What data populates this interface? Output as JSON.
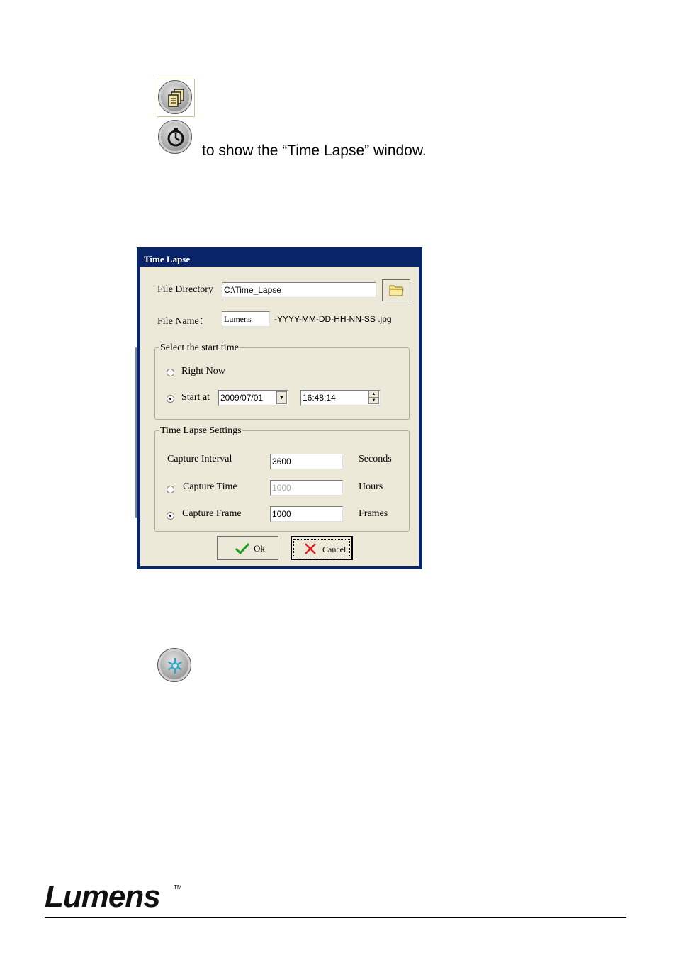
{
  "instruction_text": "to show the “Time Lapse” window.",
  "icons": {
    "stack": "stacked-pages-icon",
    "timer": "timer-icon",
    "freeze": "snowflake-icon"
  },
  "dialog": {
    "title": "Time Lapse",
    "file_directory_label": "File Directory",
    "file_directory_value": "C:\\Time_Lapse",
    "file_name_label": "File Name：",
    "file_name_value": "Lumens",
    "file_name_suffix": "-YYYY-MM-DD-HH-NN-SS .jpg",
    "start_group_title": "Select the start time",
    "right_now_label": "Right Now",
    "start_at_label": "Start at",
    "start_date": "2009/07/01",
    "start_time": "16:48:14",
    "settings_group_title": "Time Lapse Settings",
    "capture_interval_label": "Capture Interval",
    "capture_interval_value": "3600",
    "capture_interval_unit": "Seconds",
    "capture_time_label": "Capture Time",
    "capture_time_value": "1000",
    "capture_time_unit": "Hours",
    "capture_frame_label": "Capture Frame",
    "capture_frame_value": "1000",
    "capture_frame_unit": "Frames",
    "ok_label": "Ok",
    "cancel_label": "Cancel",
    "selected_start": "start_at",
    "selected_limit": "capture_frame"
  },
  "footer": {
    "brand": "Lumens",
    "trademark": "TM"
  },
  "colors": {
    "titlebar": "#0a246a",
    "dialog_bg": "#ece9d8",
    "ok_check": "#1a9a1a",
    "cancel_x": "#e02020"
  }
}
